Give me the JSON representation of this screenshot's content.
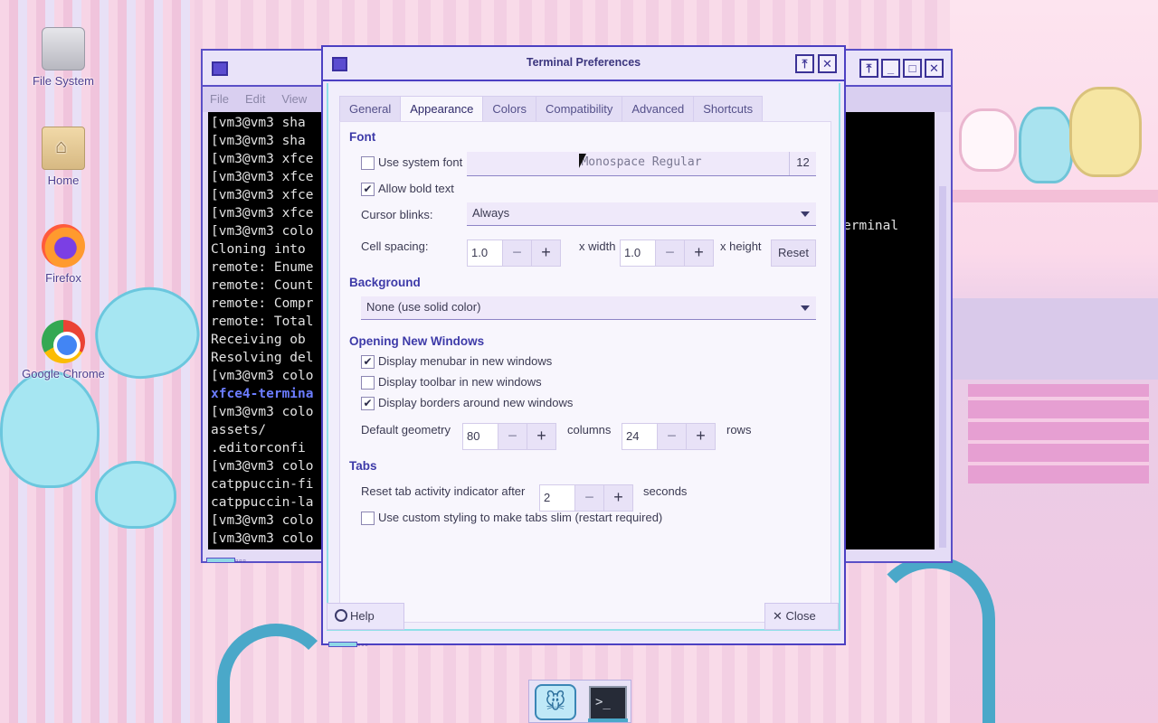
{
  "desktop": {
    "icons": [
      {
        "label": "File System",
        "icon": "drive-icon"
      },
      {
        "label": "Home",
        "icon": "home-folder-icon"
      },
      {
        "label": "Firefox",
        "icon": "firefox-icon"
      },
      {
        "label": "Google Chrome",
        "icon": "chrome-icon"
      }
    ]
  },
  "terminal": {
    "menu": [
      "File",
      "Edit",
      "View"
    ],
    "lines": [
      {
        "text": "[vm3@vm3 sha",
        "style": "normal"
      },
      {
        "text": "[vm3@vm3 sha",
        "style": "normal"
      },
      {
        "text": "[vm3@vm3 xfce",
        "style": "normal"
      },
      {
        "text": "[vm3@vm3 xfce",
        "style": "normal"
      },
      {
        "text": "[vm3@vm3 xfce",
        "style": "normal"
      },
      {
        "text": "[vm3@vm3 xfce",
        "style": "normal"
      },
      {
        "text": "[vm3@vm3 colo",
        "style": "normal"
      },
      {
        "text": "Cloning into",
        "style": "normal"
      },
      {
        "text": "remote: Enume",
        "style": "normal"
      },
      {
        "text": "remote: Count",
        "style": "normal"
      },
      {
        "text": "remote: Compr",
        "style": "normal"
      },
      {
        "text": "remote: Total",
        "style": "normal"
      },
      {
        "text": "Receiving ob",
        "style": "normal"
      },
      {
        "text": "Resolving del",
        "style": "normal"
      },
      {
        "text": "[vm3@vm3 colo",
        "style": "normal"
      },
      {
        "text": "xfce4-termina",
        "style": "hl"
      },
      {
        "text": "[vm3@vm3 colo",
        "style": "normal"
      },
      {
        "text": "assets/",
        "style": "normal"
      },
      {
        "text": ".editorconfi",
        "style": "normal"
      },
      {
        "text": "[vm3@vm3 colo",
        "style": "normal"
      },
      {
        "text": "catppuccin-fi",
        "style": "normal"
      },
      {
        "text": "catppuccin-la",
        "style": "normal"
      },
      {
        "text": "[vm3@vm3 colo",
        "style": "normal"
      },
      {
        "text": "[vm3@vm3 colo",
        "style": "normal"
      }
    ],
    "side_text": "erminal"
  },
  "dialog": {
    "title": "Terminal Preferences",
    "tabs": [
      "General",
      "Appearance",
      "Colors",
      "Compatibility",
      "Advanced",
      "Shortcuts"
    ],
    "active_tab": "Appearance",
    "font": {
      "section": "Font",
      "use_system_font_label": "Use system font",
      "use_system_font": false,
      "font_name": "Monospace Regular",
      "font_size": "12",
      "allow_bold_label": "Allow bold text",
      "allow_bold": true,
      "cursor_blinks_label": "Cursor blinks:",
      "cursor_blinks_value": "Always",
      "cell_spacing_label": "Cell spacing:",
      "width_value": "1.0",
      "width_label": "x width",
      "height_value": "1.0",
      "height_label": "x height",
      "reset_label": "Reset"
    },
    "background": {
      "section": "Background",
      "value": "None (use solid color)"
    },
    "opening": {
      "section": "Opening New Windows",
      "options": [
        {
          "label": "Display menubar in new windows",
          "checked": true
        },
        {
          "label": "Display toolbar in new windows",
          "checked": false
        },
        {
          "label": "Display borders around new windows",
          "checked": true
        }
      ],
      "geometry_label": "Default geometry",
      "columns_value": "80",
      "columns_label": "columns",
      "rows_value": "24",
      "rows_label": "rows"
    },
    "tabs_section": {
      "section": "Tabs",
      "reset_label": "Reset tab activity indicator after",
      "reset_value": "2",
      "seconds_label": "seconds",
      "slim_label": "Use custom styling to make tabs slim (restart required)",
      "slim_checked": false
    },
    "help_label": "Help",
    "close_label": "Close"
  },
  "colors": {
    "accent": "#4c40c2",
    "section_heading": "#3d3aa8",
    "terminal_highlight": "#6b7cff"
  }
}
